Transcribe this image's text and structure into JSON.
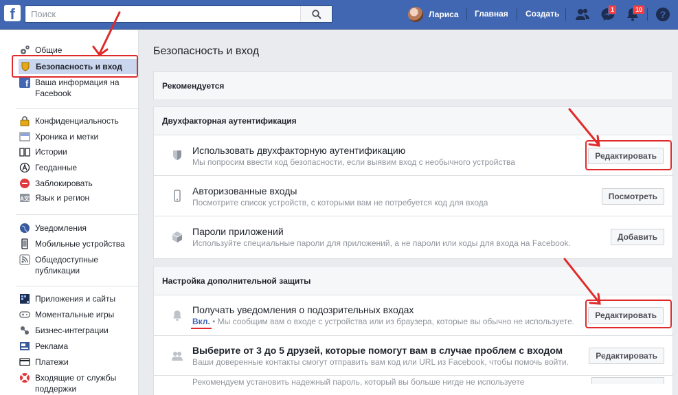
{
  "topbar": {
    "logo": "f",
    "search_placeholder": "Поиск",
    "user_name": "Лариса",
    "home_label": "Главная",
    "create_label": "Создать",
    "messages_badge": "1",
    "notifications_badge": "10",
    "brand_color": "#4267b2"
  },
  "sidebar": {
    "items": [
      {
        "label": "Общие",
        "icon": "gear-icon"
      },
      {
        "label": "Безопасность и вход",
        "icon": "shield-icon",
        "active": true
      },
      {
        "label": "Ваша информация на Facebook",
        "icon": "facebook-icon"
      },
      {
        "label": "Конфиденциальность",
        "icon": "lock-icon"
      },
      {
        "label": "Хроника и метки",
        "icon": "timeline-icon"
      },
      {
        "label": "Истории",
        "icon": "book-icon"
      },
      {
        "label": "Геоданные",
        "icon": "location-icon"
      },
      {
        "label": "Заблокировать",
        "icon": "block-icon"
      },
      {
        "label": "Язык и регион",
        "icon": "language-icon"
      },
      {
        "label": "Уведомления",
        "icon": "globe-icon"
      },
      {
        "label": "Мобильные устройства",
        "icon": "mobile-icon"
      },
      {
        "label": "Общедоступные публикации",
        "icon": "rss-icon"
      },
      {
        "label": "Приложения и сайты",
        "icon": "apps-icon"
      },
      {
        "label": "Моментальные игры",
        "icon": "gamepad-icon"
      },
      {
        "label": "Бизнес-интеграции",
        "icon": "business-icon"
      },
      {
        "label": "Реклама",
        "icon": "ads-icon"
      },
      {
        "label": "Платежи",
        "icon": "card-icon"
      },
      {
        "label": "Входящие от службы поддержки",
        "icon": "lifebuoy-icon"
      }
    ]
  },
  "main": {
    "page_title": "Безопасность и вход",
    "recommended_header": "Рекомендуется",
    "two_factor": {
      "header": "Двухфакторная аутентификация",
      "rows": [
        {
          "title": "Использовать двухфакторную аутентификацию",
          "desc": "Мы попросим ввести код безопасности, если выявим вход с необычного устройства",
          "button": "Редактировать",
          "icon": "shield-icon"
        },
        {
          "title": "Авторизованные входы",
          "desc": "Посмотрите список устройств, с которыми вам не потребуется код для входа",
          "button": "Посмотреть",
          "icon": "phone-icon"
        },
        {
          "title": "Пароли приложений",
          "desc": "Используйте специальные пароли для приложений, а не пароли или коды для входа на Facebook.",
          "button": "Добавить",
          "icon": "cube-icon"
        }
      ]
    },
    "extra_security": {
      "header": "Настройка дополнительной защиты",
      "rows": [
        {
          "title": "Получать уведомления о подозрительных входах",
          "status": "Вкл.",
          "separator": "•",
          "desc": "Мы сообщим вам о входе с устройства или из браузера, которые вы обычно не используете.",
          "button": "Редактировать",
          "icon": "bell-icon"
        },
        {
          "title": "Выберите от 3 до 5 друзей, которые помогут вам в случае проблем с входом",
          "desc": "Ваши доверенные контакты смогут отправить вам код или URL из Facebook, чтобы помочь войти.",
          "button": "Редактировать",
          "icon": "friends-icon"
        },
        {
          "desc": "Рекомендуем установить надежный пароль, который вы больше нигде не используете"
        }
      ]
    }
  },
  "annotation_color": "#e02a2a"
}
